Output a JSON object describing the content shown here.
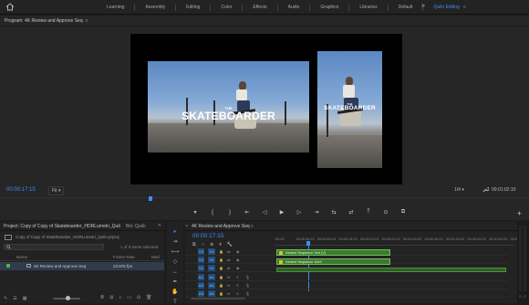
{
  "header": {
    "workspaces": [
      "Learning",
      "Assembly",
      "Editing",
      "Color",
      "Effects",
      "Audio",
      "Graphics",
      "Libraries",
      "Default",
      "Quilo Editing"
    ],
    "active_workspace": "Quilo Editing",
    "more": "»"
  },
  "program_monitor": {
    "title": "Program: 4K Review and Approve Seq",
    "menu": "≡",
    "timecode": "00:00:17:15",
    "fit": "Fit",
    "resolution": "1/4",
    "duration": "00:01:02:10",
    "video_title_small": "THE",
    "video_title": "SKATEBOARDER",
    "playhead_fraction": 0.285,
    "controls": [
      "▾",
      "{",
      "}",
      "⇤",
      "◁",
      "▶",
      "▷",
      "⇥",
      "⇆",
      "⇄",
      "⤒",
      "⊙",
      "⧉"
    ],
    "add": "+"
  },
  "project": {
    "title": "Project: Copy of Copy of Skateboarder_HDRLumetri_Quilo Editing",
    "bin": "Bin: Quilo",
    "more": "»",
    "file": "Copy of Copy of Skateboarder_HDRLumetri_Quilo.prproj",
    "search_placeholder": "",
    "item_count": "1 of 8 items selected",
    "columns": {
      "name": "Name",
      "frame_rate": "Frame Rate",
      "media": "Med"
    },
    "rows": [
      {
        "name": "4K Review and Approve Seq",
        "frame_rate": "23.976 fps"
      }
    ],
    "swatch_color": "#48b548"
  },
  "timeline": {
    "title": "4K Review and Approve Seq",
    "menu": "≡",
    "timecode": "00:00:17:15",
    "ticks": [
      ":00:00",
      "00:00:04:23",
      "00:00:09:23",
      "00:00:14:23",
      "00:00:19:23",
      "00:00:24:23",
      "00:00:29:23",
      "00:00:34:23",
      "00:00:39:23",
      "00:00:44:23",
      "00:00:49:23",
      "00:00:5"
    ],
    "tracks": [
      {
        "lock": "V3",
        "target": "V3"
      },
      {
        "lock": "V2",
        "target": "V2"
      },
      {
        "lock": "V1",
        "target": "V1"
      },
      {
        "lock": "A1",
        "target": "A1"
      },
      {
        "lock": "A2",
        "target": "A2"
      },
      {
        "lock": "A3",
        "target": "A3"
      }
    ],
    "clips": [
      {
        "label": "Nested Sequence Vert (V)"
      },
      {
        "label": "Nested Sequence 16x9"
      }
    ],
    "accent_color": "#3d8ef0",
    "clip_color": "#3d7a2f"
  }
}
